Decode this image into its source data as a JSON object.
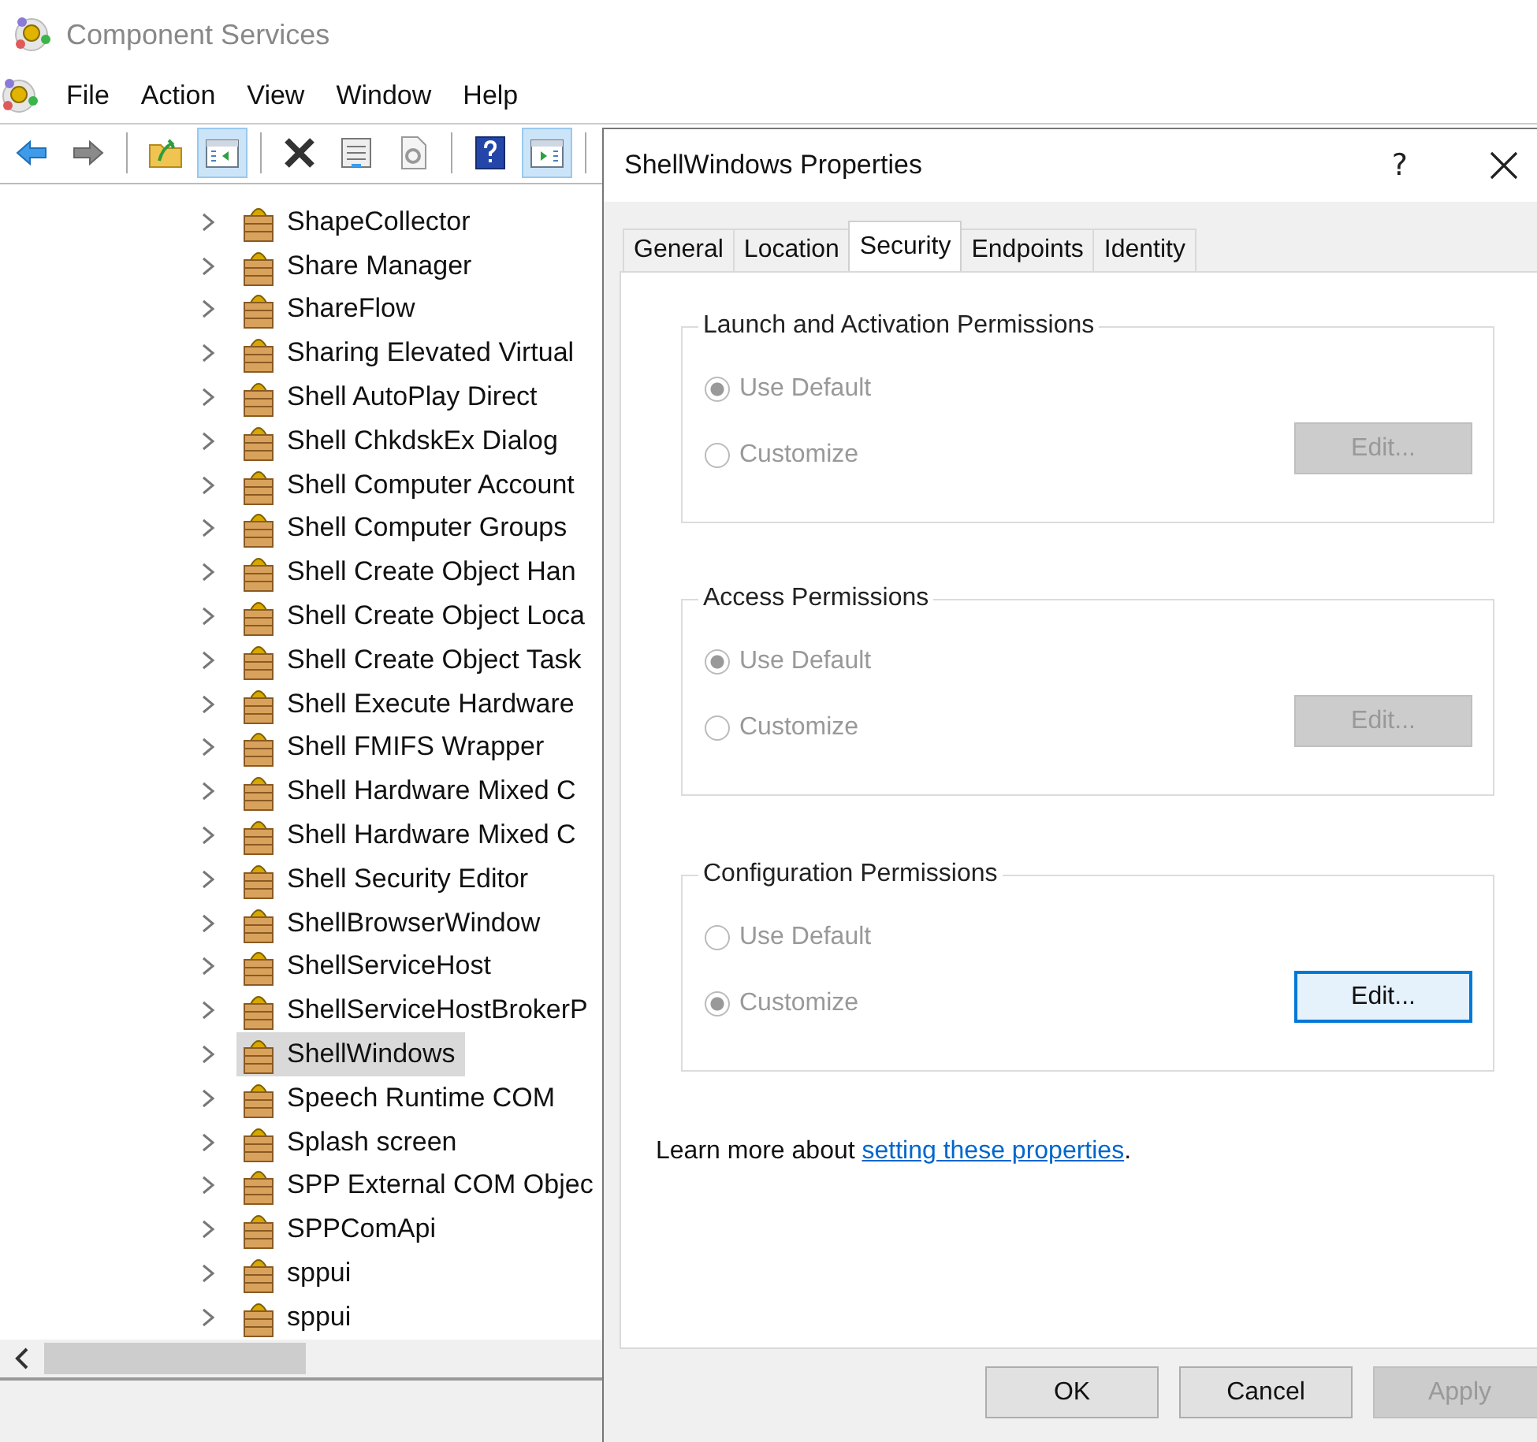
{
  "window": {
    "title": "Component Services"
  },
  "menu": [
    "File",
    "Action",
    "View",
    "Window",
    "Help"
  ],
  "toolbar": [
    {
      "kind": "back",
      "pressed": false
    },
    {
      "kind": "forward",
      "pressed": false
    },
    {
      "kind": "sep"
    },
    {
      "kind": "up",
      "pressed": false
    },
    {
      "kind": "tree",
      "pressed": true
    },
    {
      "kind": "sep"
    },
    {
      "kind": "delete",
      "pressed": false
    },
    {
      "kind": "properties",
      "pressed": false
    },
    {
      "kind": "refresh",
      "pressed": false
    },
    {
      "kind": "sep"
    },
    {
      "kind": "help",
      "pressed": false
    },
    {
      "kind": "pane",
      "pressed": true
    },
    {
      "kind": "sep"
    }
  ],
  "tree": [
    {
      "label": "ShapeCollector",
      "expanded": false,
      "selected": false
    },
    {
      "label": "Share Manager",
      "expanded": false,
      "selected": false
    },
    {
      "label": "ShareFlow",
      "expanded": false,
      "selected": false
    },
    {
      "label": "Sharing Elevated Virtual",
      "expanded": false,
      "selected": false
    },
    {
      "label": "Shell AutoPlay Direct",
      "expanded": false,
      "selected": false
    },
    {
      "label": "Shell ChkdskEx Dialog",
      "expanded": false,
      "selected": false
    },
    {
      "label": "Shell Computer Account",
      "expanded": false,
      "selected": false
    },
    {
      "label": "Shell Computer Groups",
      "expanded": false,
      "selected": false
    },
    {
      "label": "Shell Create Object Han",
      "expanded": false,
      "selected": false
    },
    {
      "label": "Shell Create Object Loca",
      "expanded": false,
      "selected": false
    },
    {
      "label": "Shell Create Object Task",
      "expanded": false,
      "selected": false
    },
    {
      "label": "Shell Execute Hardware",
      "expanded": false,
      "selected": false
    },
    {
      "label": "Shell FMIFS Wrapper",
      "expanded": false,
      "selected": false
    },
    {
      "label": "Shell Hardware Mixed C",
      "expanded": false,
      "selected": false
    },
    {
      "label": "Shell Hardware Mixed C",
      "expanded": false,
      "selected": false
    },
    {
      "label": "Shell Security Editor",
      "expanded": false,
      "selected": false
    },
    {
      "label": "ShellBrowserWindow",
      "expanded": false,
      "selected": false
    },
    {
      "label": "ShellServiceHost",
      "expanded": false,
      "selected": false
    },
    {
      "label": "ShellServiceHostBrokerP",
      "expanded": false,
      "selected": false
    },
    {
      "label": "ShellWindows",
      "expanded": false,
      "selected": true
    },
    {
      "label": "Speech Runtime COM",
      "expanded": false,
      "selected": false
    },
    {
      "label": "Splash screen",
      "expanded": false,
      "selected": false
    },
    {
      "label": "SPP External COM Objec",
      "expanded": false,
      "selected": false
    },
    {
      "label": "SPPComApi",
      "expanded": false,
      "selected": false
    },
    {
      "label": "sppui",
      "expanded": false,
      "selected": false
    },
    {
      "label": "sppui",
      "expanded": false,
      "selected": false
    }
  ],
  "dialog": {
    "title": "ShellWindows Properties",
    "help": "?",
    "tabs": [
      {
        "label": "General",
        "selected": false
      },
      {
        "label": "Location",
        "selected": false
      },
      {
        "label": "Security",
        "selected": true
      },
      {
        "label": "Endpoints",
        "selected": false
      },
      {
        "label": "Identity",
        "selected": false
      }
    ],
    "groups": [
      {
        "title": "Launch and Activation Permissions",
        "options": [
          {
            "label": "Use Default",
            "selected": true,
            "disabled": true
          },
          {
            "label": "Customize",
            "selected": false,
            "disabled": true
          }
        ],
        "edit": {
          "label": "Edit...",
          "disabled": true,
          "default": false
        }
      },
      {
        "title": "Access Permissions",
        "options": [
          {
            "label": "Use Default",
            "selected": true,
            "disabled": true
          },
          {
            "label": "Customize",
            "selected": false,
            "disabled": true
          }
        ],
        "edit": {
          "label": "Edit...",
          "disabled": true,
          "default": false
        }
      },
      {
        "title": "Configuration Permissions",
        "options": [
          {
            "label": "Use Default",
            "selected": false,
            "disabled": true
          },
          {
            "label": "Customize",
            "selected": true,
            "disabled": true
          }
        ],
        "edit": {
          "label": "Edit...",
          "disabled": false,
          "default": true
        }
      }
    ],
    "learn_more": {
      "text": "Learn more about ",
      "link": "setting these properties",
      "after": "."
    },
    "buttons": [
      {
        "label": "OK",
        "disabled": false
      },
      {
        "label": "Cancel",
        "disabled": false
      },
      {
        "label": "Apply",
        "disabled": true
      }
    ]
  }
}
